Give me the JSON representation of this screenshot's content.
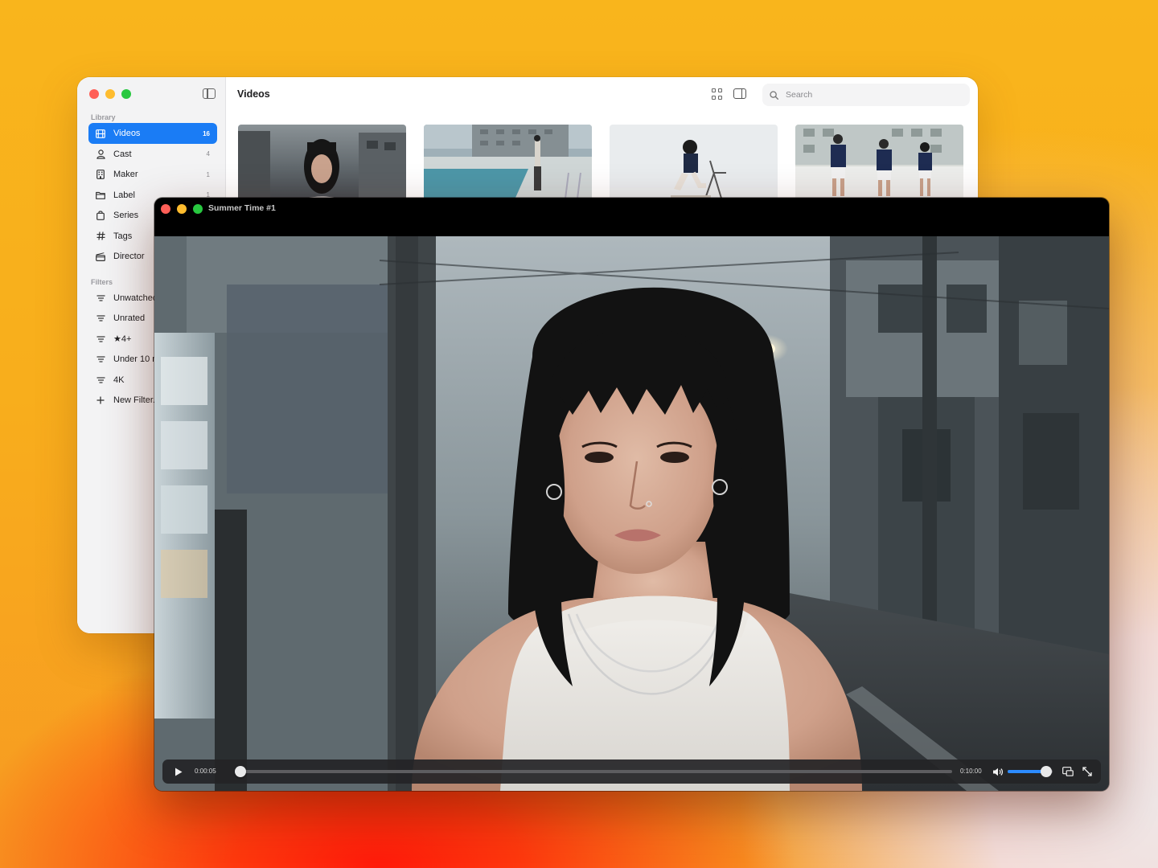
{
  "library_window": {
    "title": "Videos",
    "search": {
      "placeholder": "Search",
      "value": ""
    },
    "sidebar": {
      "library_label": "Library",
      "items": [
        {
          "icon": "film-icon",
          "label": "Videos",
          "count": "16",
          "active": true
        },
        {
          "icon": "person-icon",
          "label": "Cast",
          "count": "4"
        },
        {
          "icon": "building-icon",
          "label": "Maker",
          "count": "1"
        },
        {
          "icon": "folder-icon",
          "label": "Label",
          "count": "1"
        },
        {
          "icon": "bag-icon",
          "label": "Series",
          "count": ""
        },
        {
          "icon": "hash-icon",
          "label": "Tags",
          "count": ""
        },
        {
          "icon": "clapperboard-icon",
          "label": "Director",
          "count": ""
        }
      ],
      "filters_label": "Filters",
      "filters": [
        {
          "icon": "filter-icon",
          "label": "Unwatched"
        },
        {
          "icon": "filter-icon",
          "label": "Unrated"
        },
        {
          "icon": "filter-icon",
          "label": "★4+"
        },
        {
          "icon": "filter-icon",
          "label": "Under 10 min"
        },
        {
          "icon": "filter-icon",
          "label": "4K"
        },
        {
          "icon": "plus-icon",
          "label": "New Filter..."
        }
      ]
    },
    "thumbnails": [
      {
        "scene": "woman-portrait-street"
      },
      {
        "scene": "pool-rooftop"
      },
      {
        "scene": "person-sitting-chair"
      },
      {
        "scene": "three-people-standing"
      }
    ]
  },
  "player_window": {
    "title": "Summer Time #1",
    "current_time": "0:00:05",
    "duration": "0:10:00",
    "progress": 0.008,
    "volume": 0.86,
    "icons": [
      "play-icon",
      "speaker-icon",
      "pip-icon",
      "fullscreen-icon"
    ]
  },
  "colors": {
    "accent": "#1a7cf5",
    "progress": "#2c8bff",
    "red": "#ff5f57",
    "yellow": "#febc2e",
    "green": "#28c840"
  }
}
